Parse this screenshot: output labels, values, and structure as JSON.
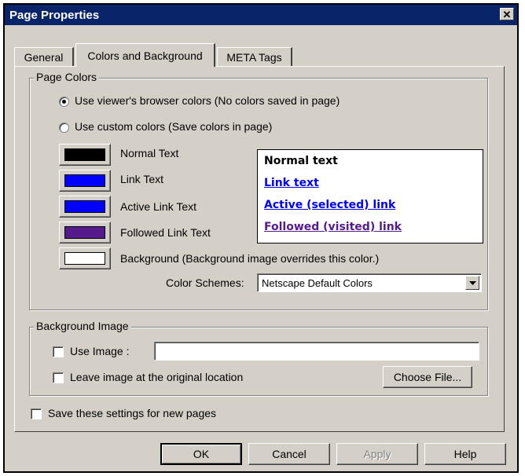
{
  "window": {
    "title": "Page Properties",
    "close_glyph": "✕"
  },
  "tabs": [
    {
      "label": "General"
    },
    {
      "label": "Colors and Background"
    },
    {
      "label": "META Tags"
    }
  ],
  "page_colors": {
    "legend": "Page Colors",
    "radio_browser": "Use viewer's browser colors (No colors saved in page)",
    "radio_custom": "Use custom colors (Save colors in page)",
    "selected": "browser",
    "items": [
      {
        "label": "Normal Text",
        "color": "#000000"
      },
      {
        "label": "Link Text",
        "color": "#0000ff"
      },
      {
        "label": "Active Link Text",
        "color": "#0000ff"
      },
      {
        "label": "Followed Link Text",
        "color": "#551a8b"
      },
      {
        "label": "Background (Background image overrides this color.)",
        "color": "#ffffff"
      }
    ],
    "preview": {
      "normal": "Normal text",
      "link": "Link text",
      "active": "Active (selected) link",
      "followed": "Followed (visited) link"
    },
    "color_schemes_label": "Color Schemes:",
    "color_scheme_value": "Netscape Default Colors"
  },
  "background_image": {
    "legend": "Background Image",
    "use_image_label": "Use Image :",
    "use_image_value": "",
    "leave_label": "Leave image at the original location",
    "choose_file": "Choose File..."
  },
  "save_settings_label": "Save these settings for new pages",
  "buttons": {
    "ok": "OK",
    "cancel": "Cancel",
    "apply": "Apply",
    "help": "Help"
  }
}
